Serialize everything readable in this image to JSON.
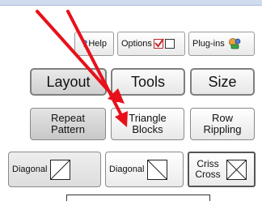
{
  "toolbar": {
    "help_label": "Help",
    "options_label": "Options",
    "plugins_label": "Plug-ins"
  },
  "tabs": [
    {
      "label": "Layout"
    },
    {
      "label": "Tools"
    },
    {
      "label": "Size"
    }
  ],
  "tool_buttons": [
    {
      "line1": "Repeat",
      "line2": "Pattern"
    },
    {
      "line1": "Triangle",
      "line2": "Blocks"
    },
    {
      "line1": "Row",
      "line2": "Rippling"
    }
  ],
  "diagonal_buttons": [
    {
      "label": "Diagonal",
      "icon": "diagonal-up-icon"
    },
    {
      "label": "Diagonal",
      "icon": "diagonal-down-icon"
    },
    {
      "line1": "Criss",
      "line2": "Cross",
      "icon": "criss-cross-icon"
    }
  ],
  "annotation_color": "#e8101a"
}
